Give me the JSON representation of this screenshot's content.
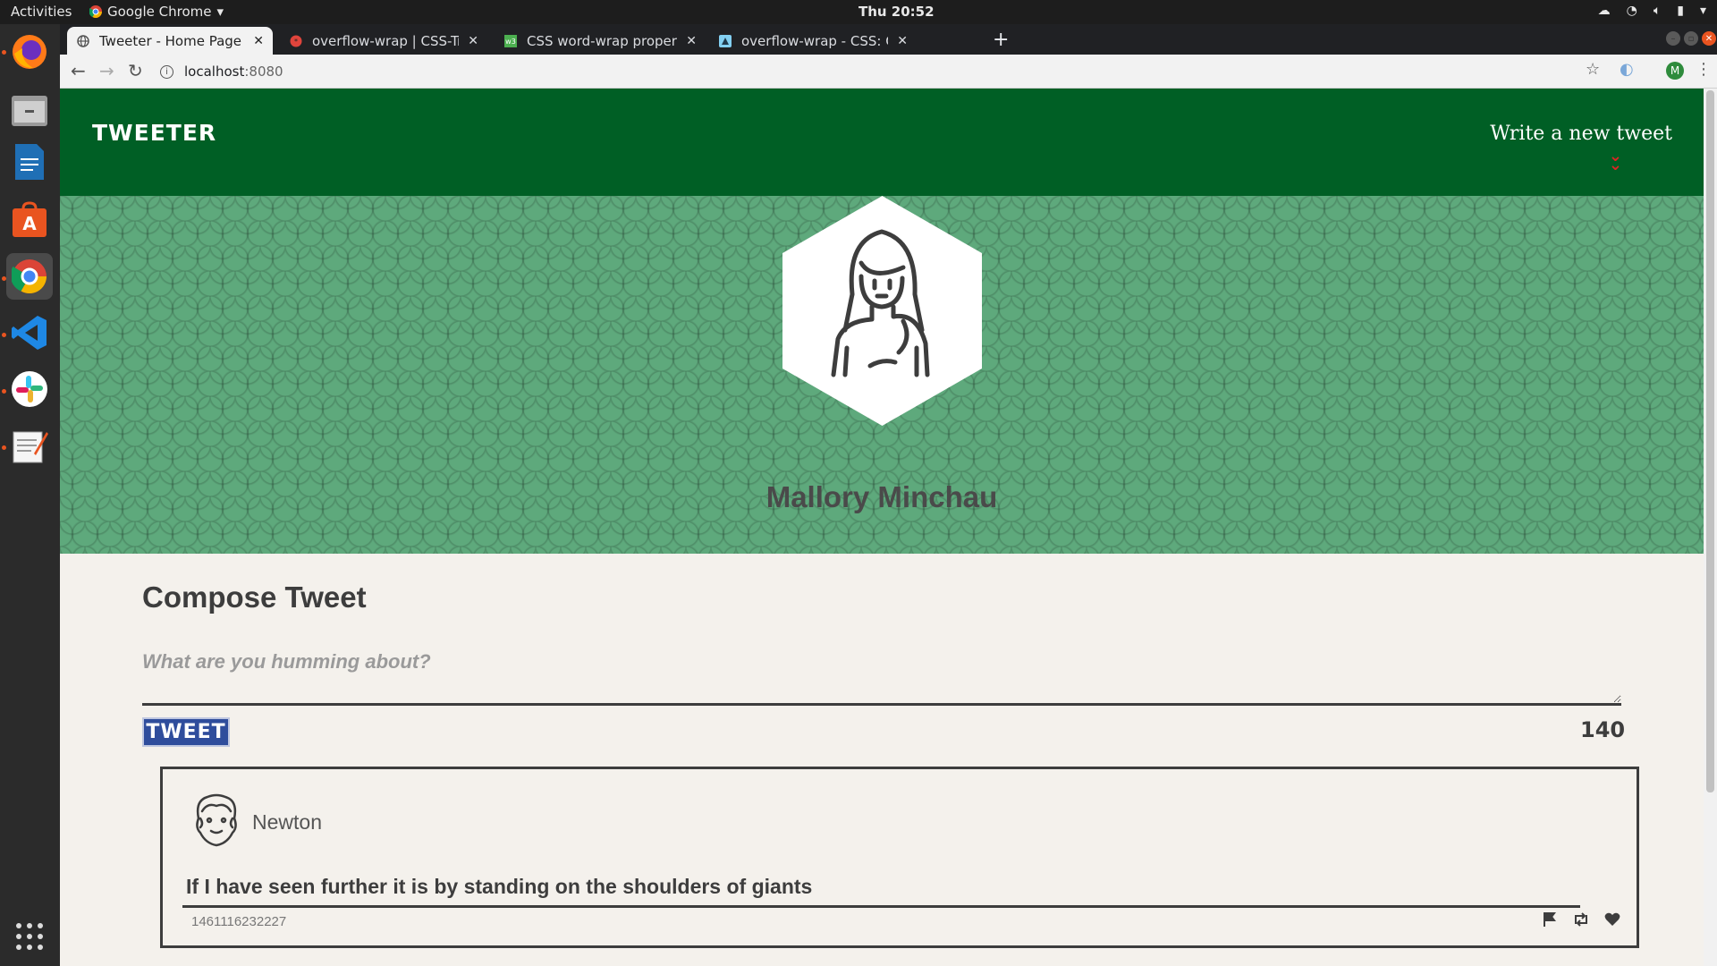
{
  "topbar": {
    "activities": "Activities",
    "app_name": "Google Chrome",
    "clock": "Thu 20:52"
  },
  "dock": {
    "apps": [
      "firefox-icon",
      "files-icon",
      "writer-icon",
      "software-center-icon",
      "chrome-icon",
      "vscode-icon",
      "slack-icon",
      "text-editor-icon"
    ]
  },
  "browser": {
    "tabs": [
      {
        "title": "Tweeter - Home Page"
      },
      {
        "title": "overflow-wrap | CSS-Trick"
      },
      {
        "title": "CSS word-wrap property"
      },
      {
        "title": "overflow-wrap - CSS: Casc"
      }
    ],
    "url_host": "localhost",
    "url_port": ":8080"
  },
  "site": {
    "brand": "TWEETER",
    "write_link": "Write a new tweet"
  },
  "profile": {
    "name": "Mallory Minchau"
  },
  "compose": {
    "title": "Compose Tweet",
    "placeholder": "What are you humming about?",
    "button": "TWEET",
    "counter": "140"
  },
  "tweets": [
    {
      "author": "Newton",
      "text": "If I have seen further it is by standing on the shoulders of giants",
      "timestamp": "1461116232227"
    }
  ],
  "colors": {
    "nav_bg": "#005f25",
    "hero_bg": "#5ea97c",
    "tweet_button": "#2f4d9c",
    "chevron": "#e02424",
    "page_bg": "#f4f1ec"
  }
}
